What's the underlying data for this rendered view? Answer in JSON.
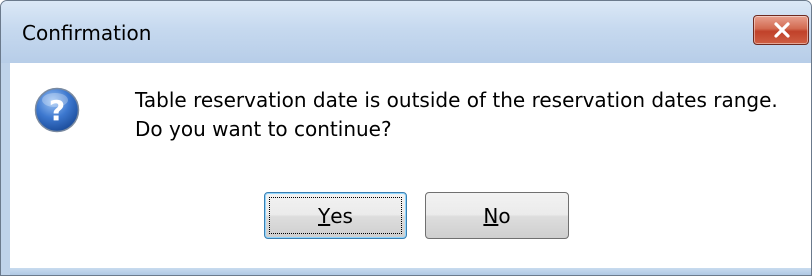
{
  "window": {
    "title": "Confirmation"
  },
  "titlebar": {
    "close_icon": "close-icon",
    "close_color": "#c0412a"
  },
  "dialog": {
    "icon": "question-icon",
    "icon_color": "#2f63b5",
    "message_lines": [
      "Table reservation date is outside of the reservation dates range.",
      "Do you want to continue?"
    ]
  },
  "buttons": {
    "yes": {
      "mnemonic": "Y",
      "rest": "es",
      "label": "Yes",
      "default": true
    },
    "no": {
      "mnemonic": "N",
      "rest": "o",
      "label": "No",
      "default": false
    }
  }
}
